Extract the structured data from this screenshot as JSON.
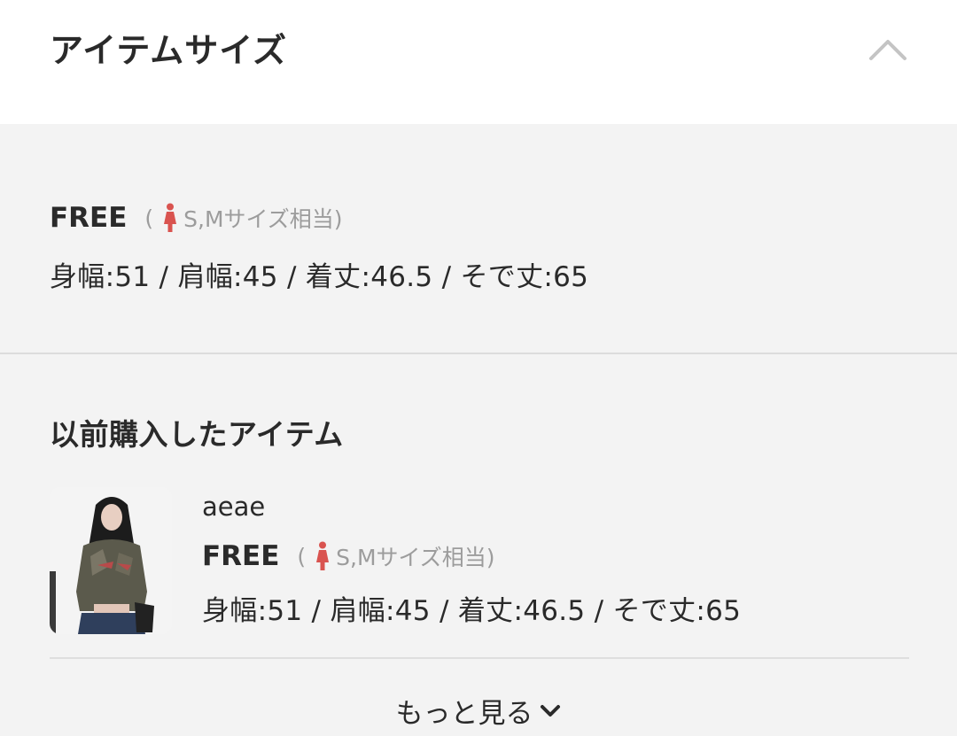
{
  "header": {
    "title": "アイテムサイズ",
    "collapse_icon": "chevron-up-icon"
  },
  "size": {
    "name": "FREE",
    "note_open": "(",
    "note_text": "S,Mサイズ相当)",
    "note_icon": "woman-icon",
    "measurements": "身幅:51 / 肩幅:45 / 着丈:46.5 / そで丈:65"
  },
  "previous": {
    "title": "以前購入したアイテム",
    "item": {
      "name": "aeae",
      "size_name": "FREE",
      "note_open": "(",
      "note_text": "S,Mサイズ相当)",
      "measurements": "身幅:51 / 肩幅:45 / 着丈:46.5 / そで丈:65"
    }
  },
  "more": {
    "label": "もっと見る",
    "icon": "chevron-down-icon"
  },
  "colors": {
    "accent_icon": "#d9534f",
    "muted_text": "#9c9c9c",
    "text": "#2a2a2a",
    "header_bg": "#ffffff",
    "body_bg": "#f3f3f3"
  }
}
